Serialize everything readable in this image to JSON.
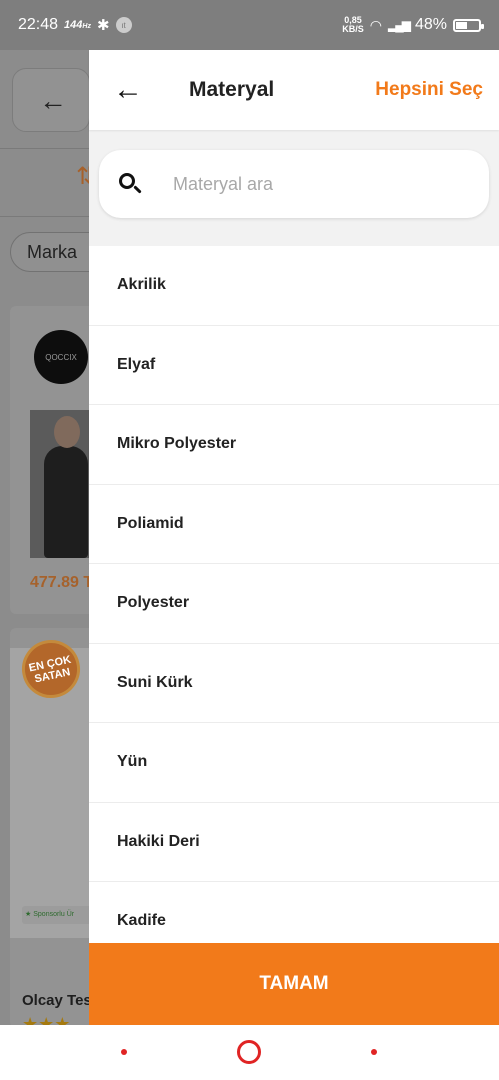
{
  "status_bar": {
    "time": "22:48",
    "refresh": "144",
    "refresh_unit": "Hz",
    "speed_value": "0,85",
    "speed_unit": "KB/S",
    "battery": "48%",
    "battery_level": 0.48
  },
  "background": {
    "filter_chip": "Marka",
    "brand_logo_text": "QOCCIX",
    "price": "477.89 T",
    "badge_line1": "EN ÇOK",
    "badge_line2": "SATAN",
    "sponsored": "Sponsorlu Ür",
    "seller": "Olcay Tes",
    "stars": "★★★"
  },
  "drawer": {
    "title": "Materyal",
    "select_all": "Hepsini Seç",
    "search_placeholder": "Materyal ara",
    "items": [
      {
        "label": "Akrilik"
      },
      {
        "label": "Elyaf"
      },
      {
        "label": "Mikro Polyester"
      },
      {
        "label": "Poliamid"
      },
      {
        "label": "Polyester"
      },
      {
        "label": "Suni Kürk"
      },
      {
        "label": "Yün"
      },
      {
        "label": "Hakiki Deri"
      },
      {
        "label": "Kadife"
      }
    ],
    "confirm": "TAMAM"
  },
  "colors": {
    "accent": "#f27a1a",
    "nav": "#e02424"
  }
}
